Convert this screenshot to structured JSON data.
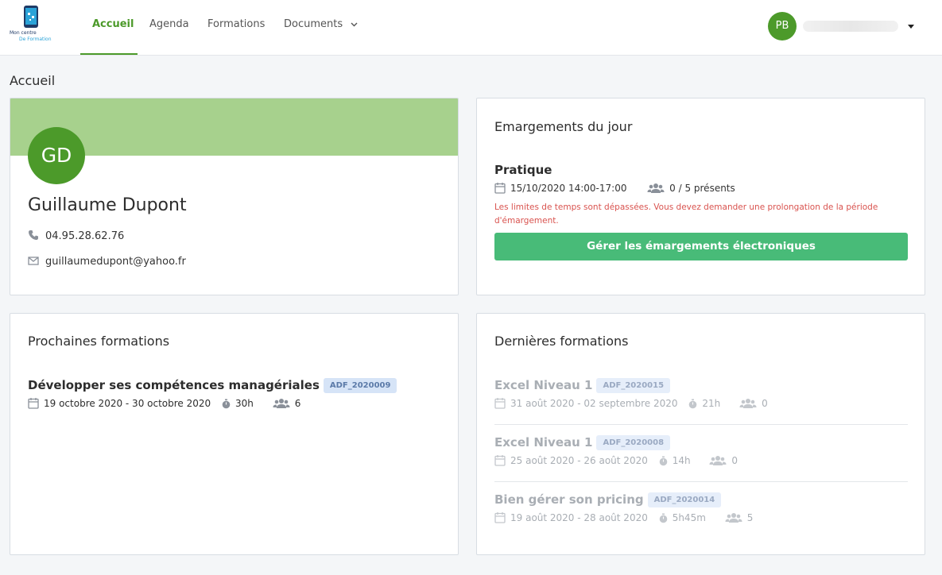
{
  "logo": {
    "line1": "Mon centre",
    "line2": "De Formation"
  },
  "nav": {
    "items": [
      {
        "label": "Accueil",
        "active": true
      },
      {
        "label": "Agenda"
      },
      {
        "label": "Formations"
      },
      {
        "label": "Documents",
        "has_dropdown": true
      }
    ]
  },
  "user": {
    "initials": "PB"
  },
  "page_title": "Accueil",
  "profile": {
    "initials": "GD",
    "name": "Guillaume Dupont",
    "phone": "04.95.28.62.76",
    "email": "guillaumedupont@yahoo.fr"
  },
  "emargements": {
    "title": "Emargements du jour",
    "session_title": "Pratique",
    "datetime": "15/10/2020 14:00-17:00",
    "attendance": "0 / 5 présents",
    "warning": "Les limites de temps sont dépassées. Vous devez demander une prolongation de la période d'émargement.",
    "button_label": "Gérer les émargements électroniques"
  },
  "upcoming": {
    "title": "Prochaines formations",
    "items": [
      {
        "title": "Développer ses compétences managériales",
        "code": "ADF_2020009",
        "dates": "19 octobre 2020 - 30 octobre 2020",
        "duration": "30h",
        "participants": "6"
      }
    ]
  },
  "past": {
    "title": "Dernières formations",
    "items": [
      {
        "title": "Excel Niveau 1",
        "code": "ADF_2020015",
        "dates": "31 août 2020 - 02 septembre 2020",
        "duration": "21h",
        "participants": "0"
      },
      {
        "title": "Excel Niveau 1",
        "code": "ADF_2020008",
        "dates": "25 août 2020 - 26 août 2020",
        "duration": "14h",
        "participants": "0"
      },
      {
        "title": "Bien gérer son pricing",
        "code": "ADF_2020014",
        "dates": "19 août 2020 - 28 août 2020",
        "duration": "5h45m",
        "participants": "5"
      }
    ]
  },
  "colors": {
    "primary_green": "#4c9a2a",
    "banner_green": "#a7d18d",
    "button_green": "#48bb78",
    "warning_red": "#d9534f"
  }
}
